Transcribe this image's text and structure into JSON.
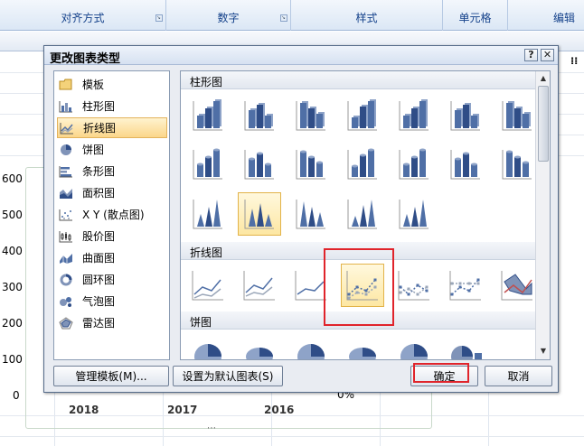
{
  "ribbon": {
    "groups": [
      "对齐方式",
      "数字",
      "样式",
      "单元格",
      "编辑"
    ]
  },
  "chart_bg": {
    "y_ticks": [
      "600",
      "500",
      "400",
      "300",
      "200",
      "100",
      "0"
    ],
    "x_ticks": [
      "2018",
      "2017",
      "2016"
    ],
    "pct_label": "0%",
    "dots": "⋯"
  },
  "dialog": {
    "title": "更改图表类型",
    "help_glyph": "?",
    "close_glyph": "✕",
    "categories": [
      {
        "label": "模板",
        "icon": "folder-icon"
      },
      {
        "label": "柱形图",
        "icon": "column-chart-icon"
      },
      {
        "label": "折线图",
        "icon": "line-chart-icon"
      },
      {
        "label": "饼图",
        "icon": "pie-chart-icon"
      },
      {
        "label": "条形图",
        "icon": "bar-chart-icon"
      },
      {
        "label": "面积图",
        "icon": "area-chart-icon"
      },
      {
        "label": "X Y (散点图)",
        "icon": "scatter-chart-icon"
      },
      {
        "label": "股价图",
        "icon": "stock-chart-icon"
      },
      {
        "label": "曲面图",
        "icon": "surface-chart-icon"
      },
      {
        "label": "圆环图",
        "icon": "doughnut-chart-icon"
      },
      {
        "label": "气泡图",
        "icon": "bubble-chart-icon"
      },
      {
        "label": "雷达图",
        "icon": "radar-chart-icon"
      }
    ],
    "selected_category": "折线图",
    "sections": {
      "column": "柱形图",
      "line": "折线图",
      "pie": "饼图"
    },
    "buttons": {
      "manage": "管理模板(M)...",
      "set_default": "设置为默认图表(S)",
      "ok": "确定",
      "cancel": "取消"
    }
  },
  "colors": {
    "accent_blue": "#4f6fa6",
    "highlight": "#fbd68a",
    "annotation_red": "#e0242b"
  }
}
